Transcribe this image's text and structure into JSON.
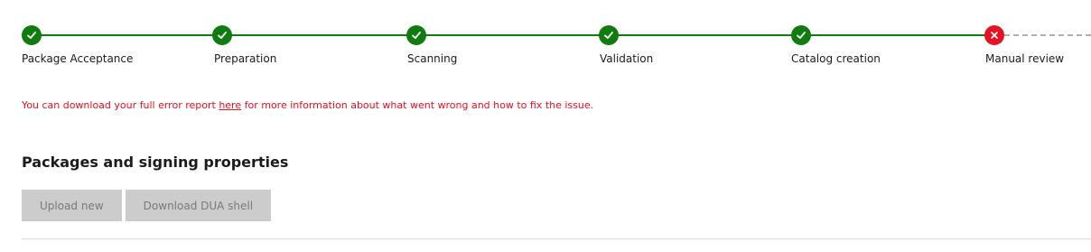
{
  "stepper": {
    "steps": [
      {
        "label": "Package Acceptance",
        "status": "complete"
      },
      {
        "label": "Preparation",
        "status": "complete"
      },
      {
        "label": "Scanning",
        "status": "complete"
      },
      {
        "label": "Validation",
        "status": "complete"
      },
      {
        "label": "Catalog creation",
        "status": "complete"
      },
      {
        "label": "Manual review",
        "status": "failed"
      }
    ],
    "colors": {
      "complete": "#107c10",
      "failed": "#e81123",
      "pending": "#b0b0b0"
    }
  },
  "error": {
    "prefix": "You can download your full error report ",
    "link_text": "here",
    "suffix": " for more information about what went wrong and how to fix the issue.",
    "color": "#e81123"
  },
  "section": {
    "title": "Packages and signing properties"
  },
  "actions": {
    "upload_label": "Upload new",
    "download_label": "Download DUA shell"
  }
}
